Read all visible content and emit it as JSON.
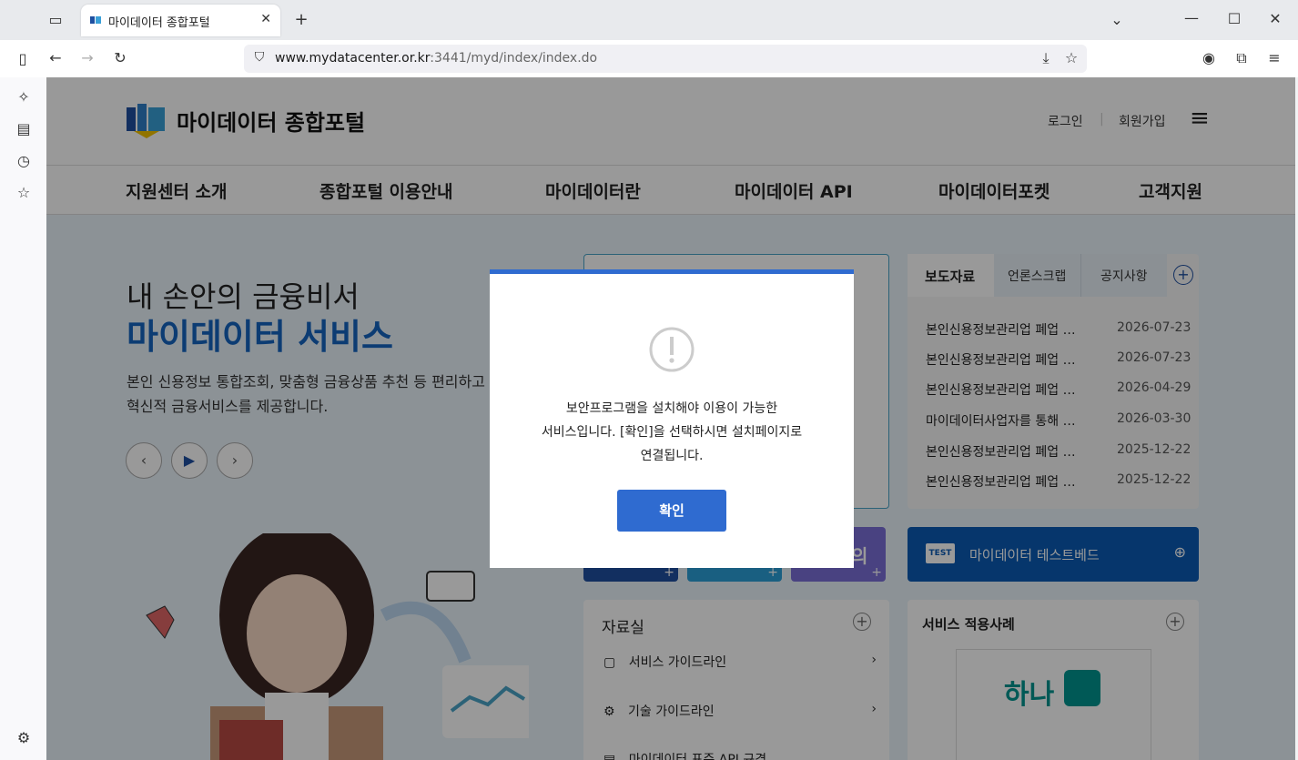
{
  "browser": {
    "tab_title": "마이데이터 종합포털",
    "url_domain": "www.mydatacenter.or.kr",
    "url_rest": ":3441/myd/index/index.do"
  },
  "site": {
    "logo_text": "마이데이터 종합포털",
    "login": "로그인",
    "signup": "회원가입",
    "nav": [
      "지원센터 소개",
      "종합포털 이용안내",
      "마이데이터란",
      "마이데이터 API",
      "마이데이터포켓",
      "고객지원"
    ]
  },
  "hero": {
    "line1": "내 손안의 금융비서",
    "line2": "마이데이터 서비스",
    "desc1": "본인 신용정보 통합조회, 맞춤형 금융상품 추천 등 편리하고",
    "desc2": "혁신적 금융서비스를 제공합니다."
  },
  "news": {
    "tabs": [
      "보도자료",
      "언론스크랩",
      "공지사항"
    ],
    "rows": [
      {
        "title": "본인신용정보관리업 폐업 …",
        "date": "2026-07-23"
      },
      {
        "title": "본인신용정보관리업 폐업 …",
        "date": "2026-07-23"
      },
      {
        "title": "본인신용정보관리업 폐업 …",
        "date": "2026-04-29"
      },
      {
        "title": "마이데이터사업자를 통해 …",
        "date": "2026-03-30"
      },
      {
        "title": "본인신용정보관리업 폐업 …",
        "date": "2025-12-22"
      },
      {
        "title": "본인신용정보관리업 폐업 …",
        "date": "2025-12-22"
      }
    ]
  },
  "testbed": {
    "badge": "TEST",
    "label": "마이데이터 테스트베드"
  },
  "library": {
    "title": "자료실",
    "items": [
      "서비스 가이드라인",
      "기술 가이드라인",
      "마이데이터 표준 API 규격"
    ]
  },
  "cases": {
    "title": "서비스 적용사례",
    "logo": "하나"
  },
  "tile_partial": "의",
  "modal": {
    "line1": "보안프로그램을 설치해야 이용이 가능한",
    "line2": "서비스입니다. [확인]을 선택하시면 설치페이지로",
    "line3": "연결됩니다.",
    "ok": "확인"
  }
}
